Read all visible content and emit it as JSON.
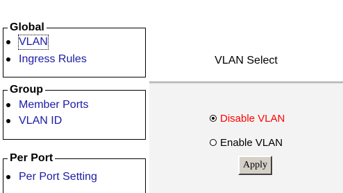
{
  "nav": {
    "groups": [
      {
        "title": "Global",
        "items": [
          {
            "label": "VLAN",
            "active": true
          },
          {
            "label": "Ingress Rules",
            "active": false
          }
        ]
      },
      {
        "title": "Group",
        "items": [
          {
            "label": "Member Ports",
            "active": false
          },
          {
            "label": "VLAN ID",
            "active": false
          }
        ]
      },
      {
        "title": "Per Port",
        "items": [
          {
            "label": "Per Port Setting",
            "active": false
          }
        ]
      }
    ]
  },
  "content": {
    "title": "VLAN Select",
    "options": [
      {
        "label": "Disable VLAN",
        "checked": true,
        "color": "#ff0000"
      },
      {
        "label": "Enable VLAN",
        "checked": false,
        "color": "#000000"
      }
    ],
    "apply_label": "Apply"
  },
  "colors": {
    "link": "#1a1aa6",
    "form_background": "#f3f3f3",
    "button_face": "#d4d0c8"
  }
}
